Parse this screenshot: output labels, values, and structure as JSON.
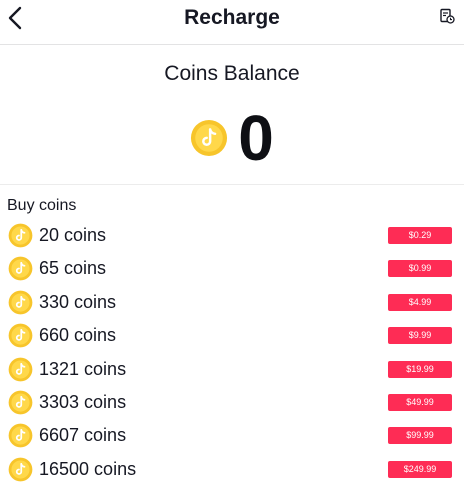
{
  "header": {
    "back_icon": "chevron-left-icon",
    "title": "Recharge",
    "history_icon": "transaction-history-icon"
  },
  "balance": {
    "title": "Coins Balance",
    "coin_icon": "tiktok-coin-icon",
    "amount": "0"
  },
  "buy": {
    "label": "Buy coins",
    "packages": [
      {
        "coins": "20 coins",
        "price": "$0.29"
      },
      {
        "coins": "65 coins",
        "price": "$0.99"
      },
      {
        "coins": "330 coins",
        "price": "$4.99"
      },
      {
        "coins": "660 coins",
        "price": "$9.99"
      },
      {
        "coins": "1321 coins",
        "price": "$19.99"
      },
      {
        "coins": "3303 coins",
        "price": "$49.99"
      },
      {
        "coins": "6607 coins",
        "price": "$99.99"
      },
      {
        "coins": "16500 coins",
        "price": "$249.99"
      }
    ]
  },
  "colors": {
    "price_badge": "#fe2c55",
    "coin_outer": "#f7c52b",
    "coin_inner": "#ffd84a",
    "text": "#161823"
  }
}
